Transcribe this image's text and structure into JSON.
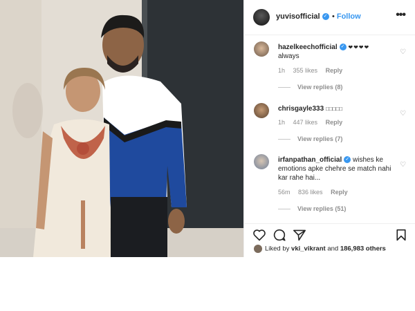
{
  "post": {
    "username": "yuvisofficial",
    "follow_label": "Follow",
    "dot": "•",
    "more_icon": "more-horizontal-icon",
    "verified_color": "#3897f0"
  },
  "comments": [
    {
      "username": "hazelkeechofficial",
      "verified": true,
      "text": "❤❤❤❤",
      "text_line2": "always",
      "time": "1h",
      "likes": "355 likes",
      "reply": "Reply",
      "view_replies": "View replies (8)"
    },
    {
      "username": "chrisgayle333",
      "verified": false,
      "text": "□□□□□",
      "time": "1h",
      "likes": "447 likes",
      "reply": "Reply",
      "view_replies": "View replies (7)"
    },
    {
      "username": "irfanpathan_official",
      "verified": true,
      "text": "wishes ke emotions apke chehre se match nahi kar rahe hai...",
      "time": "56m",
      "likes": "836 likes",
      "reply": "Reply",
      "view_replies": "View replies (51)"
    }
  ],
  "liked_by": {
    "prefix": "Liked by",
    "user": "vki_vikrant",
    "and": "and",
    "count": "186,983 others"
  },
  "icons": {
    "like": "heart-icon",
    "comment": "comment-icon",
    "share": "share-icon",
    "save": "bookmark-icon"
  }
}
